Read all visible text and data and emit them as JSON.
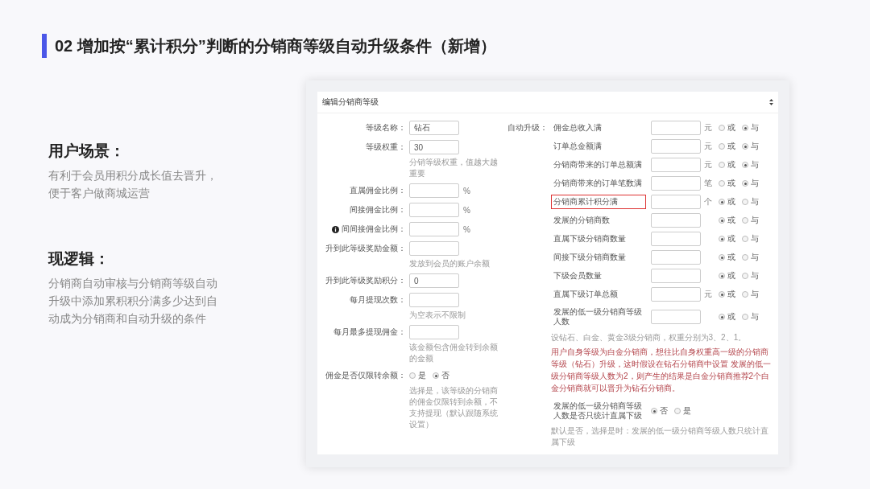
{
  "slide_title": "02 增加按“累计积分”判断的分销商等级自动升级条件（新增）",
  "sections": [
    {
      "heading": "用户场景：",
      "body": "有利于会员用积分成长值去晋升，便于客户做商城运营"
    },
    {
      "heading": "现逻辑：",
      "body": "分销商自动审核与分销商等级自动升级中添加累积积分满多少达到自动成为分销商和自动升级的条件"
    }
  ],
  "form": {
    "title": "编辑分销商等级",
    "fields": [
      {
        "kind": "text",
        "label": "等级名称：",
        "value": "钻石"
      },
      {
        "kind": "text",
        "label": "等级权重：",
        "value": "30",
        "hint": "分销等级权重，值越大越重要"
      },
      {
        "kind": "text",
        "label": "直属佣金比例：",
        "unit": "%"
      },
      {
        "kind": "text",
        "label": "间接佣金比例：",
        "unit": "%"
      },
      {
        "kind": "text",
        "label": "间间接佣金比例：",
        "unit": "%",
        "info": true
      },
      {
        "kind": "text",
        "label": "升到此等级奖励金额：",
        "hint": "发放到会员的账户余额"
      },
      {
        "kind": "text",
        "label": "升到此等级奖励积分：",
        "value": "0"
      },
      {
        "kind": "text",
        "label": "每月提现次数：",
        "hint": "为空表示不限制"
      },
      {
        "kind": "text",
        "label": "每月最多提现佣金：",
        "hint": "该金额包含佣金转到余额的金额"
      },
      {
        "kind": "radio",
        "label": "佣金是否仅限转余额：",
        "options": [
          {
            "label": "是",
            "selected": false
          },
          {
            "label": "否",
            "selected": true
          }
        ],
        "hint": "选择是，该等级的分销商的佣金仅限转到余额，不支持提现（默认跟随系统设置）"
      }
    ],
    "auto_upgrade": {
      "label": "自动升级：",
      "conditions": [
        {
          "label": "佣金总收入满",
          "unit": "元",
          "highlighted": false,
          "options": [
            {
              "label": "或",
              "selected": false
            },
            {
              "label": "与",
              "selected": true
            }
          ]
        },
        {
          "label": "订单总金额满",
          "unit": "元",
          "highlighted": false,
          "options": [
            {
              "label": "或",
              "selected": false
            },
            {
              "label": "与",
              "selected": true
            }
          ]
        },
        {
          "label": "分销商带来的订单总额满",
          "unit": "元",
          "highlighted": false,
          "options": [
            {
              "label": "或",
              "selected": false
            },
            {
              "label": "与",
              "selected": true
            }
          ]
        },
        {
          "label": "分销商带来的订单笔数满",
          "unit": "笔",
          "highlighted": false,
          "options": [
            {
              "label": "或",
              "selected": false
            },
            {
              "label": "与",
              "selected": true
            }
          ]
        },
        {
          "label": "分销商累计积分满",
          "unit": "个",
          "highlighted": true,
          "options": [
            {
              "label": "或",
              "selected": true
            },
            {
              "label": "与",
              "selected": false
            }
          ]
        },
        {
          "label": "发展的分销商数",
          "highlighted": false,
          "options": [
            {
              "label": "或",
              "selected": true
            },
            {
              "label": "与",
              "selected": false
            }
          ]
        },
        {
          "label": "直属下级分销商数量",
          "highlighted": false,
          "options": [
            {
              "label": "或",
              "selected": true
            },
            {
              "label": "与",
              "selected": false
            }
          ]
        },
        {
          "label": "间接下级分销商数量",
          "highlighted": false,
          "options": [
            {
              "label": "或",
              "selected": true
            },
            {
              "label": "与",
              "selected": false
            }
          ]
        },
        {
          "label": "下级会员数量",
          "highlighted": false,
          "options": [
            {
              "label": "或",
              "selected": true
            },
            {
              "label": "与",
              "selected": false
            }
          ]
        },
        {
          "label": "直属下级订单总额",
          "unit": "元",
          "highlighted": false,
          "options": [
            {
              "label": "或",
              "selected": true
            },
            {
              "label": "与",
              "selected": false
            }
          ]
        },
        {
          "label": "发展的低一级分销商等级人数",
          "highlighted": false,
          "options": [
            {
              "label": "或",
              "selected": true
            },
            {
              "label": "与",
              "selected": false
            }
          ]
        }
      ],
      "notes": [
        {
          "kind": "plain",
          "text": "设钻石、白金、黄金3级分销商，权重分别为3、2、1。"
        },
        {
          "kind": "warning",
          "text": "用户自身等级为白金分销商，想往比自身权重高一级的分销商等级（钻石）升级，这时假设在钻石分销商中设置 发展的低一级分销商等级人数为2，则产生的结果是白金分销商推荐2个白金分销商就可以晋升为钻石分销商。"
        }
      ],
      "direct_only": {
        "label": "发展的低一级分销商等级人数是否只统计直属下级",
        "options": [
          {
            "label": "否",
            "selected": true
          },
          {
            "label": "是",
            "selected": false
          }
        ],
        "hint": "默认是否，选择是时：发展的低一级分销商等级人数只统计直属下级"
      }
    }
  }
}
